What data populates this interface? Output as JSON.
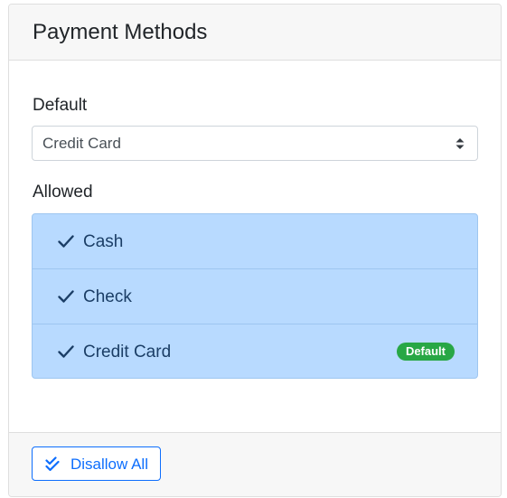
{
  "card": {
    "title": "Payment Methods"
  },
  "default_field": {
    "label": "Default",
    "selected": "Credit Card"
  },
  "allowed_field": {
    "label": "Allowed",
    "items": [
      {
        "label": "Cash",
        "checked": true
      },
      {
        "label": "Check",
        "checked": true
      },
      {
        "label": "Credit Card",
        "checked": true,
        "badge": "Default"
      }
    ]
  },
  "footer": {
    "disallow_all_label": "Disallow All"
  },
  "colors": {
    "list_bg": "#b8daff",
    "list_text": "#1b3e66",
    "badge_bg": "#28a745",
    "accent": "#0d6efd"
  },
  "icons": {
    "select_caret": "caret-up-down-icon",
    "check": "check-icon",
    "disallow": "double-check-icon"
  }
}
